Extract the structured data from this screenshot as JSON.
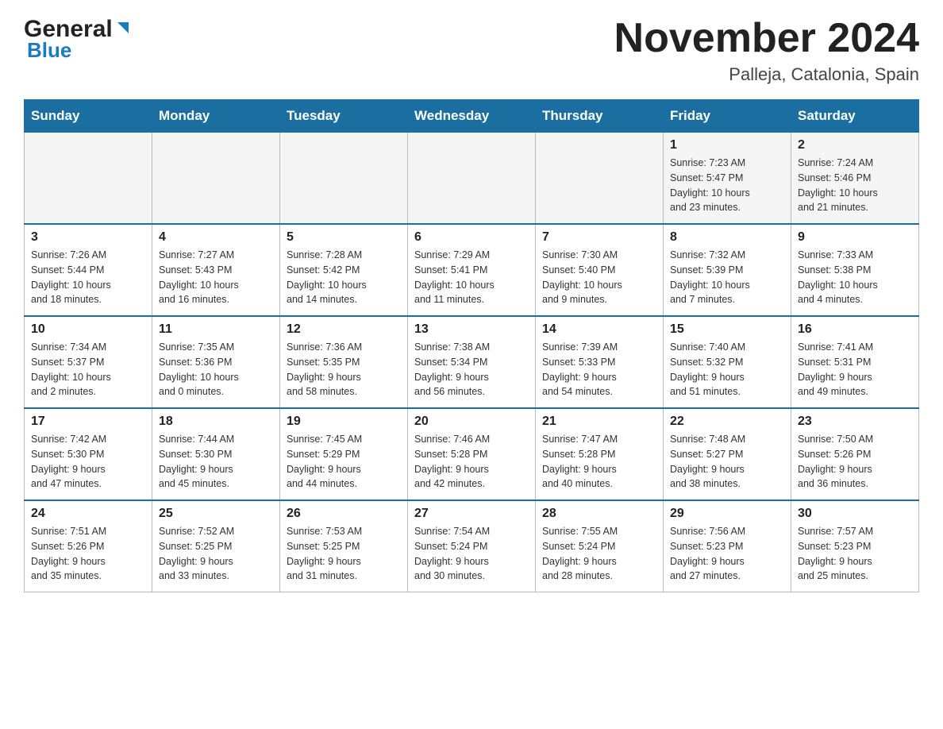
{
  "header": {
    "logo_general": "General",
    "logo_blue": "Blue",
    "month_title": "November 2024",
    "location": "Palleja, Catalonia, Spain"
  },
  "weekdays": [
    "Sunday",
    "Monday",
    "Tuesday",
    "Wednesday",
    "Thursday",
    "Friday",
    "Saturday"
  ],
  "weeks": [
    [
      {
        "day": "",
        "info": ""
      },
      {
        "day": "",
        "info": ""
      },
      {
        "day": "",
        "info": ""
      },
      {
        "day": "",
        "info": ""
      },
      {
        "day": "",
        "info": ""
      },
      {
        "day": "1",
        "info": "Sunrise: 7:23 AM\nSunset: 5:47 PM\nDaylight: 10 hours\nand 23 minutes."
      },
      {
        "day": "2",
        "info": "Sunrise: 7:24 AM\nSunset: 5:46 PM\nDaylight: 10 hours\nand 21 minutes."
      }
    ],
    [
      {
        "day": "3",
        "info": "Sunrise: 7:26 AM\nSunset: 5:44 PM\nDaylight: 10 hours\nand 18 minutes."
      },
      {
        "day": "4",
        "info": "Sunrise: 7:27 AM\nSunset: 5:43 PM\nDaylight: 10 hours\nand 16 minutes."
      },
      {
        "day": "5",
        "info": "Sunrise: 7:28 AM\nSunset: 5:42 PM\nDaylight: 10 hours\nand 14 minutes."
      },
      {
        "day": "6",
        "info": "Sunrise: 7:29 AM\nSunset: 5:41 PM\nDaylight: 10 hours\nand 11 minutes."
      },
      {
        "day": "7",
        "info": "Sunrise: 7:30 AM\nSunset: 5:40 PM\nDaylight: 10 hours\nand 9 minutes."
      },
      {
        "day": "8",
        "info": "Sunrise: 7:32 AM\nSunset: 5:39 PM\nDaylight: 10 hours\nand 7 minutes."
      },
      {
        "day": "9",
        "info": "Sunrise: 7:33 AM\nSunset: 5:38 PM\nDaylight: 10 hours\nand 4 minutes."
      }
    ],
    [
      {
        "day": "10",
        "info": "Sunrise: 7:34 AM\nSunset: 5:37 PM\nDaylight: 10 hours\nand 2 minutes."
      },
      {
        "day": "11",
        "info": "Sunrise: 7:35 AM\nSunset: 5:36 PM\nDaylight: 10 hours\nand 0 minutes."
      },
      {
        "day": "12",
        "info": "Sunrise: 7:36 AM\nSunset: 5:35 PM\nDaylight: 9 hours\nand 58 minutes."
      },
      {
        "day": "13",
        "info": "Sunrise: 7:38 AM\nSunset: 5:34 PM\nDaylight: 9 hours\nand 56 minutes."
      },
      {
        "day": "14",
        "info": "Sunrise: 7:39 AM\nSunset: 5:33 PM\nDaylight: 9 hours\nand 54 minutes."
      },
      {
        "day": "15",
        "info": "Sunrise: 7:40 AM\nSunset: 5:32 PM\nDaylight: 9 hours\nand 51 minutes."
      },
      {
        "day": "16",
        "info": "Sunrise: 7:41 AM\nSunset: 5:31 PM\nDaylight: 9 hours\nand 49 minutes."
      }
    ],
    [
      {
        "day": "17",
        "info": "Sunrise: 7:42 AM\nSunset: 5:30 PM\nDaylight: 9 hours\nand 47 minutes."
      },
      {
        "day": "18",
        "info": "Sunrise: 7:44 AM\nSunset: 5:30 PM\nDaylight: 9 hours\nand 45 minutes."
      },
      {
        "day": "19",
        "info": "Sunrise: 7:45 AM\nSunset: 5:29 PM\nDaylight: 9 hours\nand 44 minutes."
      },
      {
        "day": "20",
        "info": "Sunrise: 7:46 AM\nSunset: 5:28 PM\nDaylight: 9 hours\nand 42 minutes."
      },
      {
        "day": "21",
        "info": "Sunrise: 7:47 AM\nSunset: 5:28 PM\nDaylight: 9 hours\nand 40 minutes."
      },
      {
        "day": "22",
        "info": "Sunrise: 7:48 AM\nSunset: 5:27 PM\nDaylight: 9 hours\nand 38 minutes."
      },
      {
        "day": "23",
        "info": "Sunrise: 7:50 AM\nSunset: 5:26 PM\nDaylight: 9 hours\nand 36 minutes."
      }
    ],
    [
      {
        "day": "24",
        "info": "Sunrise: 7:51 AM\nSunset: 5:26 PM\nDaylight: 9 hours\nand 35 minutes."
      },
      {
        "day": "25",
        "info": "Sunrise: 7:52 AM\nSunset: 5:25 PM\nDaylight: 9 hours\nand 33 minutes."
      },
      {
        "day": "26",
        "info": "Sunrise: 7:53 AM\nSunset: 5:25 PM\nDaylight: 9 hours\nand 31 minutes."
      },
      {
        "day": "27",
        "info": "Sunrise: 7:54 AM\nSunset: 5:24 PM\nDaylight: 9 hours\nand 30 minutes."
      },
      {
        "day": "28",
        "info": "Sunrise: 7:55 AM\nSunset: 5:24 PM\nDaylight: 9 hours\nand 28 minutes."
      },
      {
        "day": "29",
        "info": "Sunrise: 7:56 AM\nSunset: 5:23 PM\nDaylight: 9 hours\nand 27 minutes."
      },
      {
        "day": "30",
        "info": "Sunrise: 7:57 AM\nSunset: 5:23 PM\nDaylight: 9 hours\nand 25 minutes."
      }
    ]
  ]
}
